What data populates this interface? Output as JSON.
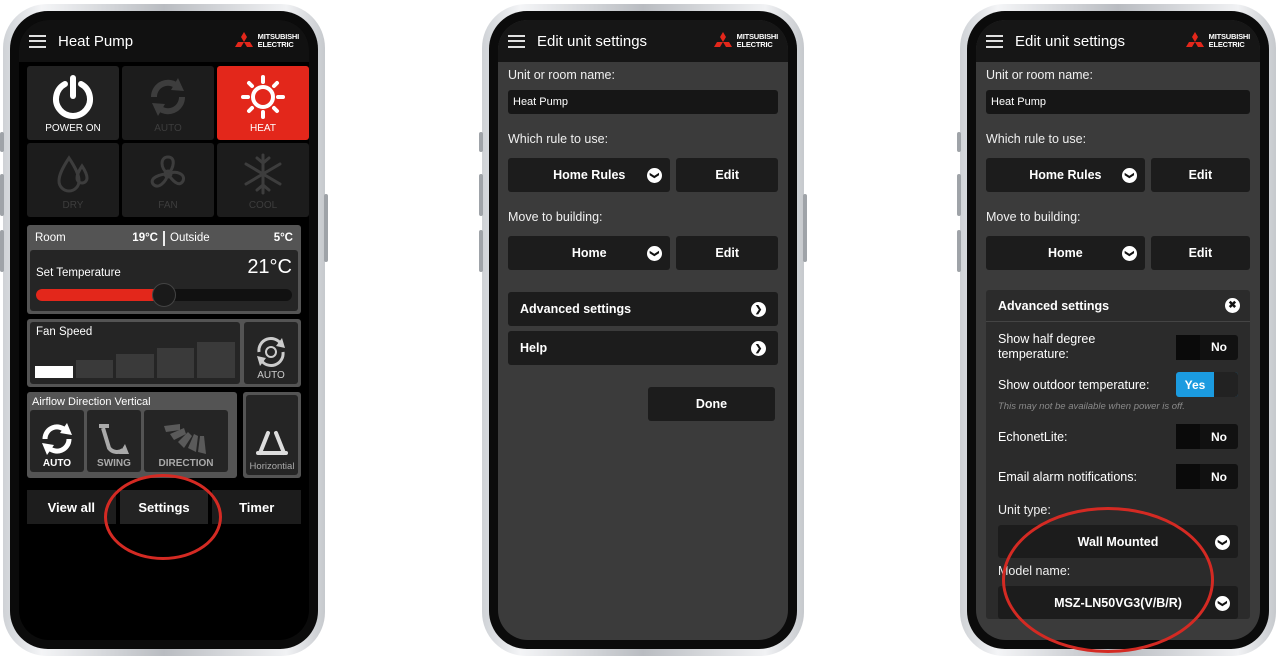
{
  "screen1": {
    "title": "Heat Pump",
    "logo": {
      "line1": "MITSUBISHI",
      "line2": "ELECTRIC",
      "color": "#e3271b"
    },
    "modes": [
      {
        "label": "POWER ON",
        "icon": "power-icon",
        "state": "on"
      },
      {
        "label": "AUTO",
        "icon": "auto-cycle-icon",
        "state": "off"
      },
      {
        "label": "HEAT",
        "icon": "sun-icon",
        "state": "active"
      },
      {
        "label": "DRY",
        "icon": "droplet-icon",
        "state": "off"
      },
      {
        "label": "FAN",
        "icon": "fan-icon",
        "state": "off"
      },
      {
        "label": "COOL",
        "icon": "snowflake-icon",
        "state": "off"
      }
    ],
    "room_label": "Room",
    "room_value": "19°C",
    "outside_label": "Outside",
    "outside_value": "5°C",
    "set_temp_label": "Set Temperature",
    "set_temp_value": "21°C",
    "set_temp_level": 0.5,
    "fan_speed_label": "Fan Speed",
    "fan_speed_level": 1,
    "fan_auto_label": "AUTO",
    "airflow_label": "Airflow Direction Vertical",
    "airflow_buttons": [
      {
        "label": "AUTO",
        "icon": "auto-cycle-icon"
      },
      {
        "label": "SWING",
        "icon": "swing-icon"
      },
      {
        "label": "DIRECTION",
        "icon": "direction-vanes-icon"
      }
    ],
    "horizontal_label": "Horizontial",
    "tabs": [
      "View all",
      "Settings",
      "Timer"
    ],
    "highlight_color": "#d42a23"
  },
  "screen2": {
    "title": "Edit unit settings",
    "unit_name_label": "Unit or room name:",
    "unit_name_value": "Heat Pump",
    "rule_label": "Which rule to use:",
    "rule_value": "Home Rules",
    "rule_edit": "Edit",
    "building_label": "Move to building:",
    "building_value": "Home",
    "building_edit": "Edit",
    "advanced_label": "Advanced settings",
    "help_label": "Help",
    "done_label": "Done"
  },
  "screen3": {
    "title": "Edit unit settings",
    "unit_name_label": "Unit or room name:",
    "unit_name_value": "Heat Pump",
    "rule_label": "Which rule to use:",
    "rule_value": "Home Rules",
    "rule_edit": "Edit",
    "building_label": "Move to building:",
    "building_value": "Home",
    "building_edit": "Edit",
    "advanced_label": "Advanced settings",
    "half_degree_label": "Show half degree temperature:",
    "half_degree_value": "No",
    "outdoor_label": "Show outdoor temperature:",
    "outdoor_value": "Yes",
    "outdoor_hint": "This may not be available when power is off.",
    "echonet_label": "EchonetLite:",
    "echonet_value": "No",
    "email_label": "Email alarm notifications:",
    "email_value": "No",
    "unit_type_label": "Unit type:",
    "unit_type_value": "Wall Mounted",
    "model_label": "Model name:",
    "model_value": "MSZ-LN50VG3(V/B/R)",
    "toggle_on_color": "#1b9be0"
  }
}
